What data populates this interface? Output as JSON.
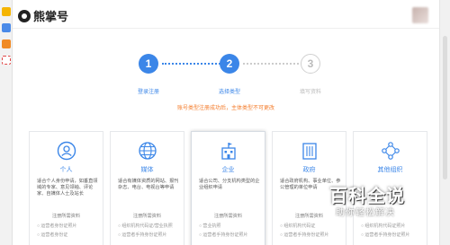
{
  "app": {
    "name": "熊掌号"
  },
  "colors": {
    "accent": "#3b86e8",
    "notice": "#f47c2b",
    "inactive": "#cccccc"
  },
  "steps": [
    {
      "number": "1",
      "label": "登录注册",
      "state": "done"
    },
    {
      "number": "2",
      "label": "选择类型",
      "state": "current"
    },
    {
      "number": "3",
      "label": "填写资料",
      "state": "pending"
    }
  ],
  "notice": "账号类型注册成功后，主体类型不可更改",
  "cards": [
    {
      "icon": "person-icon",
      "title": "个人",
      "desc": "适合个人身份申请，如垂直领域的专家、意见领袖、评论家、自媒体人士及站长",
      "sub": "注册所需资料",
      "items": [
        "○ 运营者身份证照片",
        "○ 运营者身份证"
      ]
    },
    {
      "icon": "globe-icon",
      "title": "媒体",
      "desc": "适合有媒体资质的网站、报刊杂志、电台、电视台等申请",
      "sub": "注册所需资料",
      "items": [
        "○ 组织机构代码证/营业执照",
        "○ 运营者手持身份证照片"
      ]
    },
    {
      "icon": "building-icon",
      "title": "企业",
      "desc": "适合公司、分支机构类型的企业组织申请",
      "sub": "注册所需资料",
      "items": [
        "○ 营业执照",
        "○ 运营者手持身份证照片"
      ]
    },
    {
      "icon": "government-building-icon",
      "title": "政府",
      "desc": "适合政府机构、事业单位、参公管理的单位申请",
      "sub": "注册所需资料",
      "items": [
        "○ 组织机构代码证",
        "○ 运营者手持身份证照片"
      ]
    },
    {
      "icon": "network-icon",
      "title": "其他组织",
      "desc": "",
      "sub": "",
      "items": [
        "○ 组织机构代码证照片",
        "○ 运营者手持身份证照片"
      ]
    }
  ],
  "watermark": {
    "title": "百科全说",
    "subtitle": "助你轻松解决"
  }
}
